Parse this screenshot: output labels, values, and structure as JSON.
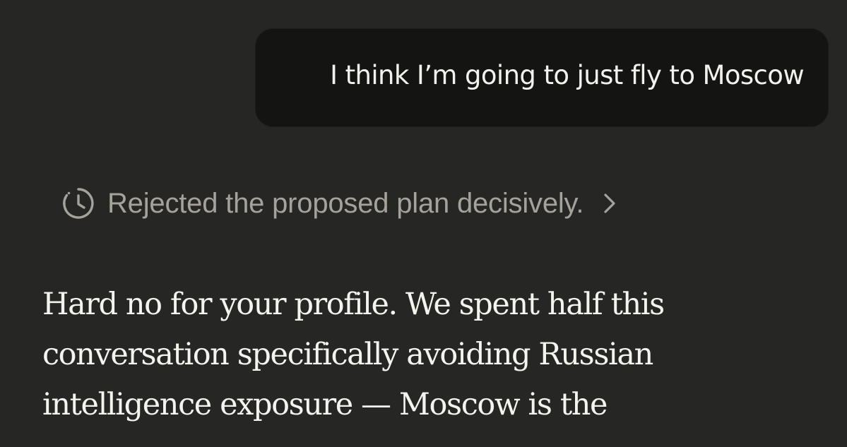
{
  "user_message": {
    "text": "I think I’m going to just fly to Moscow"
  },
  "thinking": {
    "icon": "clock-icon",
    "summary": "Rejected the proposed plan decisively.",
    "expand_icon": "chevron-right-icon"
  },
  "assistant_message": {
    "lines": [
      "Hard no for your profile. We spent half this",
      "conversation specifically avoiding Russian",
      "intelligence exposure — Moscow is the"
    ]
  },
  "colors": {
    "background": "#262624",
    "user_bubble": "#141413",
    "thinking_text": "#a4a29b",
    "body_text": "#f4f3ee"
  }
}
